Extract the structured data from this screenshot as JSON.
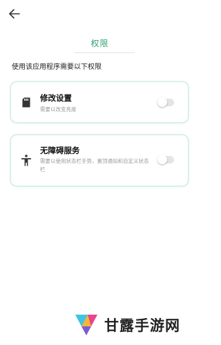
{
  "header": {
    "title": "权限",
    "back_icon": "arrow-left-icon"
  },
  "subtitle": "使用该应用程序需要以下权限",
  "permissions": [
    {
      "title": "修改设置",
      "description": "需要以改变亮度",
      "icon": "sd-card-icon",
      "enabled": false
    },
    {
      "title": "无障碍服务",
      "description": "需要以使用状态栏手势，置顶通知和自定义状态栏",
      "icon": "accessibility-icon",
      "enabled": false
    }
  ],
  "watermark": {
    "brand": "甘露手游网"
  },
  "colors": {
    "accent": "#2e9f6f",
    "card_border": "#cfeede",
    "toggle_track": "#e5e5e5"
  }
}
